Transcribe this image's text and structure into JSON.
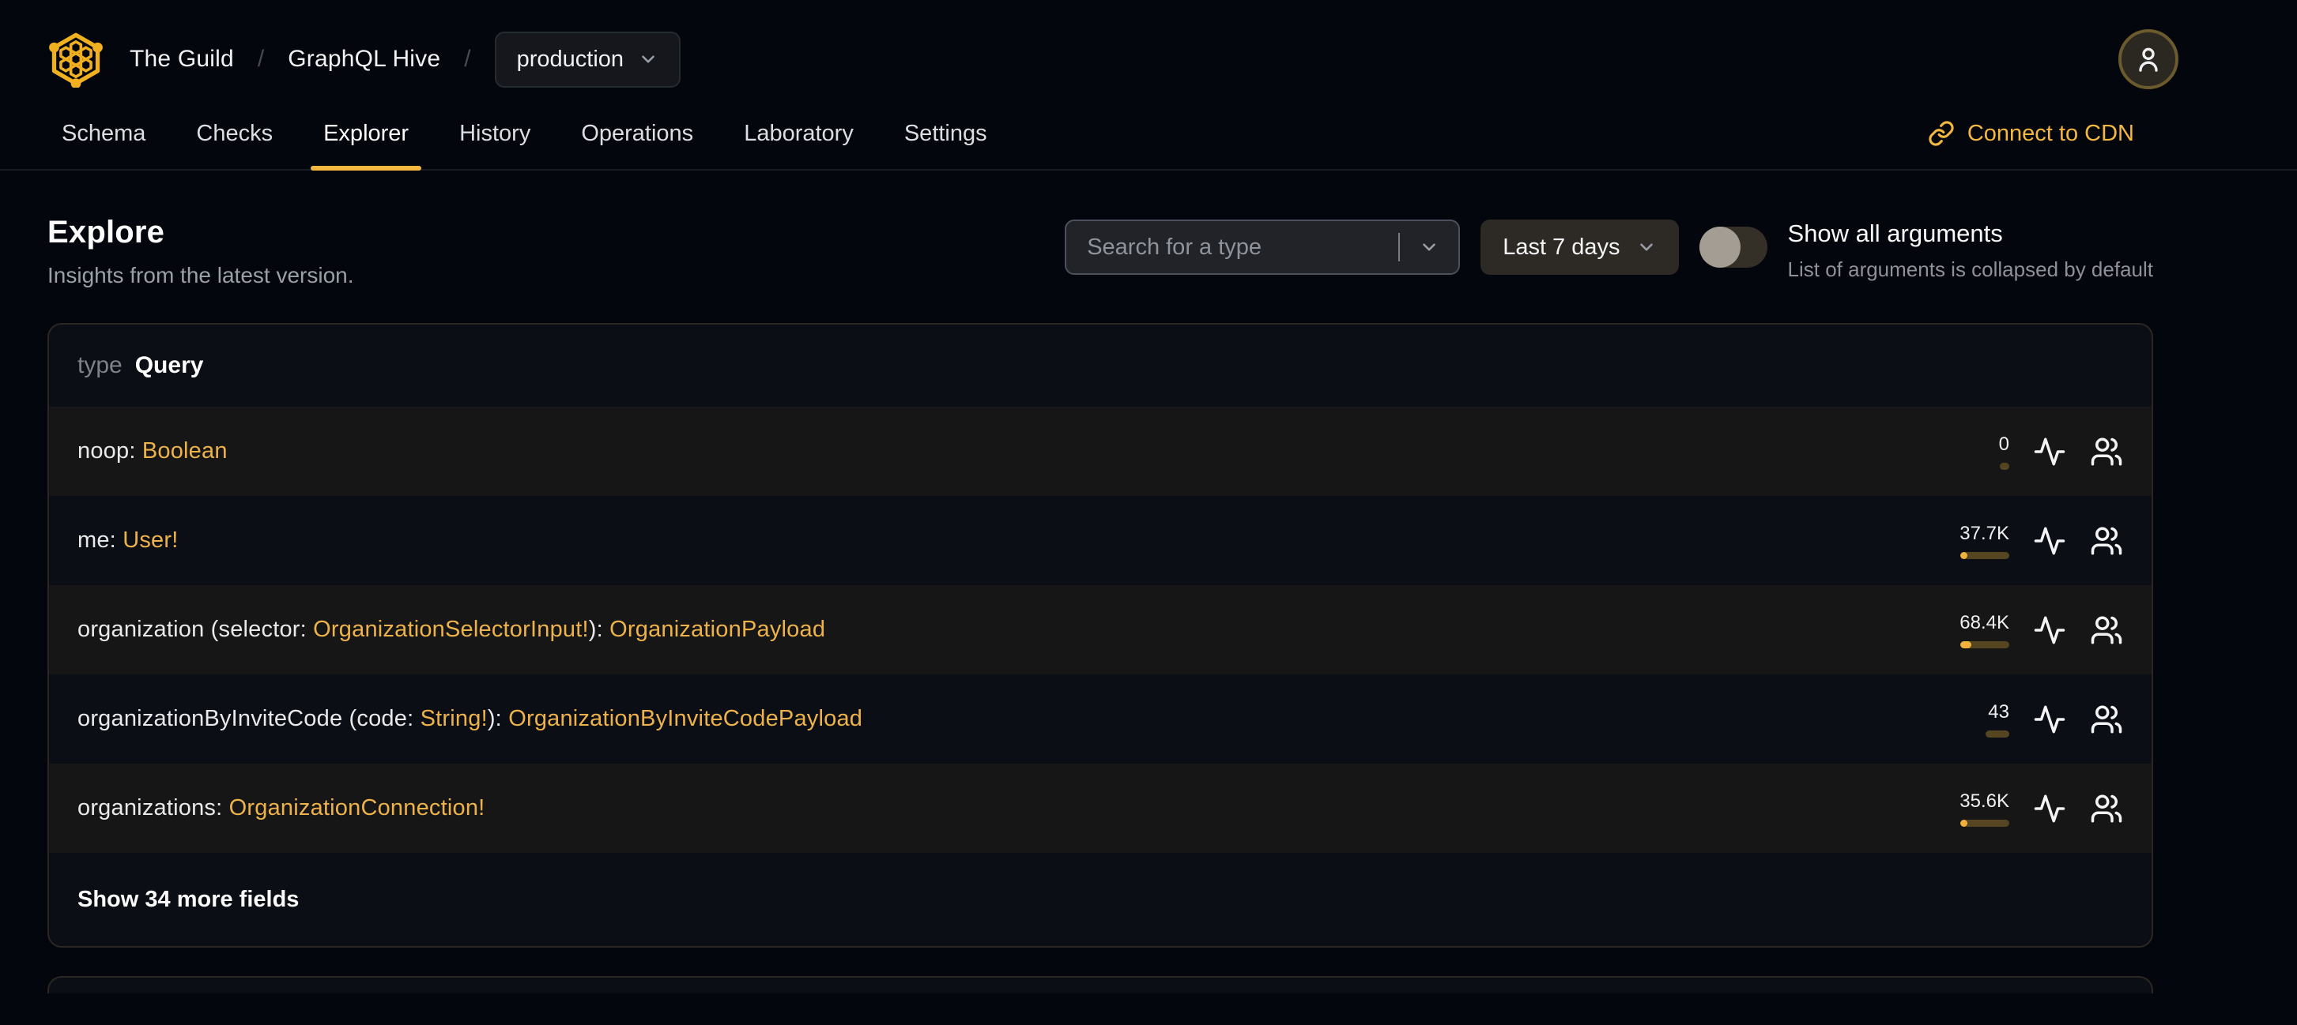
{
  "header": {
    "breadcrumb": {
      "org": "The Guild",
      "separator": "/",
      "project": "GraphQL Hive",
      "target": "production"
    },
    "tabs": [
      {
        "label": "Schema",
        "active": false
      },
      {
        "label": "Checks",
        "active": false
      },
      {
        "label": "Explorer",
        "active": true
      },
      {
        "label": "History",
        "active": false
      },
      {
        "label": "Operations",
        "active": false
      },
      {
        "label": "Laboratory",
        "active": false
      },
      {
        "label": "Settings",
        "active": false
      }
    ],
    "connect_cdn_label": "Connect to CDN"
  },
  "page": {
    "title": "Explore",
    "subtitle": "Insights from the latest version.",
    "search": {
      "placeholder": "Search for a type"
    },
    "period": {
      "selected": "Last 7 days"
    },
    "arguments_toggle": {
      "state": "off",
      "label": "Show all arguments",
      "hint": "List of arguments is collapsed by default"
    }
  },
  "type_card": {
    "keyword": "type",
    "name": "Query",
    "fields": [
      {
        "parts": [
          {
            "text": "noop: ",
            "kind": "plain"
          },
          {
            "text": "Boolean",
            "kind": "type"
          }
        ],
        "count": "0",
        "bar": {
          "track": 12,
          "fill": 0
        }
      },
      {
        "parts": [
          {
            "text": "me: ",
            "kind": "plain"
          },
          {
            "text": "User!",
            "kind": "type"
          }
        ],
        "count": "37.7K",
        "bar": {
          "track": 62,
          "fill": 9
        }
      },
      {
        "parts": [
          {
            "text": "organization (selector: ",
            "kind": "plain"
          },
          {
            "text": "OrganizationSelectorInput!",
            "kind": "type"
          },
          {
            "text": "): ",
            "kind": "plain"
          },
          {
            "text": "OrganizationPayload",
            "kind": "type"
          }
        ],
        "count": "68.4K",
        "bar": {
          "track": 62,
          "fill": 14
        }
      },
      {
        "parts": [
          {
            "text": "organizationByInviteCode (code: ",
            "kind": "plain"
          },
          {
            "text": "String!",
            "kind": "type"
          },
          {
            "text": "): ",
            "kind": "plain"
          },
          {
            "text": "OrganizationByInviteCodePayload",
            "kind": "type"
          }
        ],
        "count": "43",
        "bar": {
          "track": 30,
          "fill": 0
        }
      },
      {
        "parts": [
          {
            "text": "organizations: ",
            "kind": "plain"
          },
          {
            "text": "OrganizationConnection!",
            "kind": "type"
          }
        ],
        "count": "35.6K",
        "bar": {
          "track": 62,
          "fill": 9
        }
      }
    ],
    "show_more_label": "Show 34 more fields"
  },
  "colors": {
    "accent": "#f4b740",
    "type_text": "#eeb24a",
    "bar_track": "#554520",
    "bar_fill": "#f2b13c",
    "page_bg": "#04060d",
    "card_bg": "#0b0e15",
    "row_alt_bg": "#161616"
  }
}
